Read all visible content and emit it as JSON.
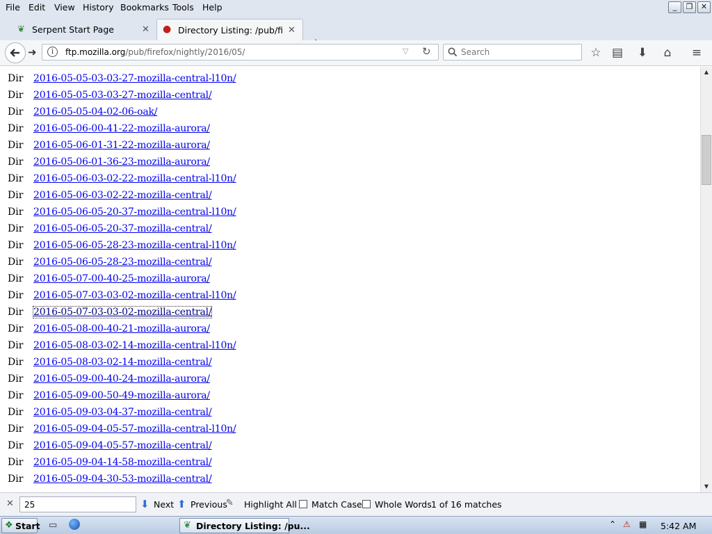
{
  "menu": {
    "items": [
      "File",
      "Edit",
      "View",
      "History",
      "Bookmarks",
      "Tools",
      "Help"
    ]
  },
  "tabs": [
    {
      "title": "Serpent Start Page",
      "active": false
    },
    {
      "title": "Directory Listing: /pub/firefc",
      "active": true
    }
  ],
  "url": {
    "host": "ftp.mozilla.org",
    "path": "/pub/firefox/nightly/2016/05/"
  },
  "search": {
    "placeholder": "Search"
  },
  "listing": {
    "type_label": "Dir",
    "focused_index": 14,
    "entries": [
      "2016-05-05-03-03-27-mozilla-central-l10n/",
      "2016-05-05-03-03-27-mozilla-central/",
      "2016-05-05-04-02-06-oak/",
      "2016-05-06-00-41-22-mozilla-aurora/",
      "2016-05-06-01-31-22-mozilla-aurora/",
      "2016-05-06-01-36-23-mozilla-aurora/",
      "2016-05-06-03-02-22-mozilla-central-l10n/",
      "2016-05-06-03-02-22-mozilla-central/",
      "2016-05-06-05-20-37-mozilla-central-l10n/",
      "2016-05-06-05-20-37-mozilla-central/",
      "2016-05-06-05-28-23-mozilla-central-l10n/",
      "2016-05-06-05-28-23-mozilla-central/",
      "2016-05-07-00-40-25-mozilla-aurora/",
      "2016-05-07-03-03-02-mozilla-central-l10n/",
      "2016-05-07-03-03-02-mozilla-central/",
      "2016-05-08-00-40-21-mozilla-aurora/",
      "2016-05-08-03-02-14-mozilla-central-l10n/",
      "2016-05-08-03-02-14-mozilla-central/",
      "2016-05-09-00-40-24-mozilla-aurora/",
      "2016-05-09-00-50-49-mozilla-aurora/",
      "2016-05-09-03-04-37-mozilla-central/",
      "2016-05-09-04-05-57-mozilla-central-l10n/",
      "2016-05-09-04-05-57-mozilla-central/",
      "2016-05-09-04-14-58-mozilla-central/",
      "2016-05-09-04-30-53-mozilla-central/"
    ]
  },
  "findbar": {
    "query": "25",
    "next_label": "Next",
    "previous_label": "Previous",
    "highlight_label": "Highlight All",
    "match_case_label": "Match Case",
    "whole_words_label": "Whole Words",
    "status": "1 of 16 matches"
  },
  "taskbar": {
    "start_label": "Start",
    "task_label": "Directory Listing: /pu...",
    "clock": "5:42 AM"
  },
  "colors": {
    "link": "#0000ee",
    "chrome": "#dfe6f0"
  }
}
